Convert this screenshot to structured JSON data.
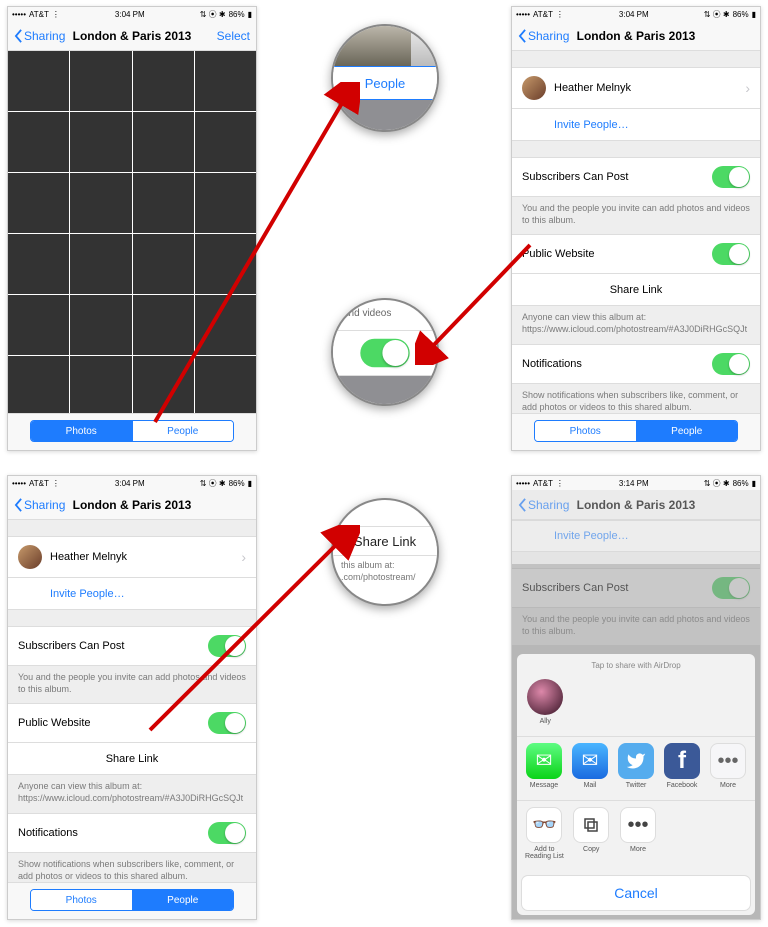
{
  "status": {
    "carrier": "AT&T",
    "time": "3:04 PM",
    "time_alt": "3:14 PM",
    "battery": "86%"
  },
  "nav": {
    "back": "Sharing",
    "title": "London & Paris 2013",
    "select": "Select"
  },
  "seg": {
    "photos": "Photos",
    "people": "People"
  },
  "people": {
    "user": "Heather Melnyk",
    "invite": "Invite People…",
    "sub_label": "Subscribers Can Post",
    "sub_footer": "You and the people you invite can add photos and videos to this album.",
    "pub_label": "Public Website",
    "share_link": "Share Link",
    "share_footer1": "Anyone can view this album at:",
    "share_footer2": "https://www.icloud.com/photostream/#A3J0DiRHGcSQJt",
    "notif_label": "Notifications",
    "notif_footer": "Show notifications when subscribers like, comment, or add photos or videos to this shared album."
  },
  "share": {
    "airdrop": "Tap to share with AirDrop",
    "ally": "Ally",
    "message": "Message",
    "mail": "Mail",
    "twitter": "Twitter",
    "facebook": "Facebook",
    "more": "More",
    "reading": "Add to Reading List",
    "copy": "Copy",
    "cancel": "Cancel"
  },
  "mag": {
    "people_tab": "People",
    "videos_hint": "and videos",
    "share_link": "Share Link",
    "album_at": "this album at:",
    "url_frag": ".com/photostream/"
  }
}
